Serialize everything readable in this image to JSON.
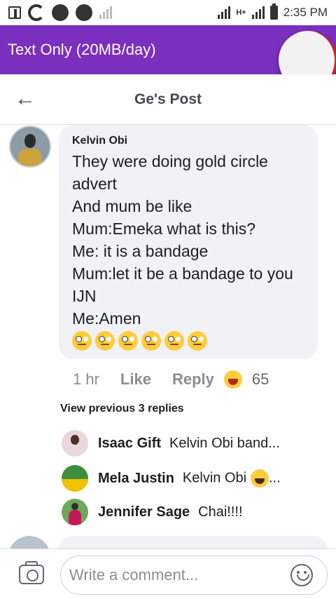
{
  "status_bar": {
    "network": "H+",
    "time": "2:35 PM"
  },
  "banner": {
    "title": "Text Only (20MB/day)"
  },
  "header": {
    "title": "Ge's Post"
  },
  "comment": {
    "author": "Kelvin Obi",
    "text": "They were doing gold circle advert\nAnd mum be like\nMum:Emeka what is this?\nMe: it is a bandage\nMum:let it be a bandage to you IJN\nMe:Amen",
    "emoji_count": 6,
    "emoji_name": "face-with-rolling-eyes",
    "time": "1 hr",
    "like_label": "Like",
    "reply_label": "Reply",
    "reaction_name": "laughing-face",
    "reaction_count": "65"
  },
  "replies": {
    "view_previous_label": "View previous 3 replies",
    "items": [
      {
        "name": "Isaac Gift",
        "text": "Kelvin Obi band..."
      },
      {
        "name": "Mela Justin",
        "text": "Kelvin Obi",
        "trailing": "..."
      },
      {
        "name": "Jennifer Sage",
        "text": "Chai!!!!"
      }
    ]
  },
  "composer": {
    "placeholder": "Write a comment..."
  },
  "colors": {
    "brand_purple": "#7b2fbf",
    "bubble_gray": "#f0f2f5",
    "muted_text": "#8a8d91"
  }
}
